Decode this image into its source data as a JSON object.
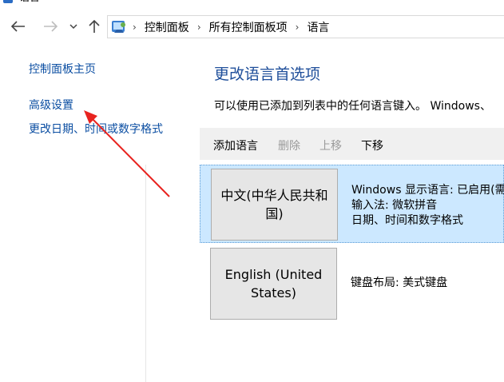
{
  "window": {
    "title": "语言"
  },
  "nav": {
    "back_icon": "back-arrow-icon",
    "forward_icon": "forward-arrow-icon",
    "recent_icon": "chevron-down-icon",
    "up_icon": "up-arrow-icon"
  },
  "breadcrumb": [
    "控制面板",
    "所有控制面板项",
    "语言"
  ],
  "sidebar": {
    "items": [
      {
        "label": "控制面板主页"
      },
      {
        "label": "高级设置"
      },
      {
        "label": "更改日期、时间或数字格式"
      }
    ]
  },
  "main": {
    "title": "更改语言首选项",
    "description": "可以使用已添加到列表中的任何语言键入。 Windows、",
    "toolbar": {
      "add": "添加语言",
      "remove": "删除",
      "move_up": "上移",
      "move_down": "下移"
    },
    "languages": [
      {
        "name": "中文(中华人民共和国)",
        "details": [
          "Windows 显示语言: 已启用(需",
          "输入法: 微软拼音",
          "日期、时间和数字格式"
        ]
      },
      {
        "name": "English (United States)",
        "details": [
          "键盘布局: 美式键盘"
        ]
      }
    ]
  },
  "colors": {
    "link": "#0b4ea2",
    "title": "#1e4e9a",
    "selected_row": "#cce8ff",
    "disabled_text": "#9a9a9a",
    "annotation_arrow": "#e8231f"
  }
}
